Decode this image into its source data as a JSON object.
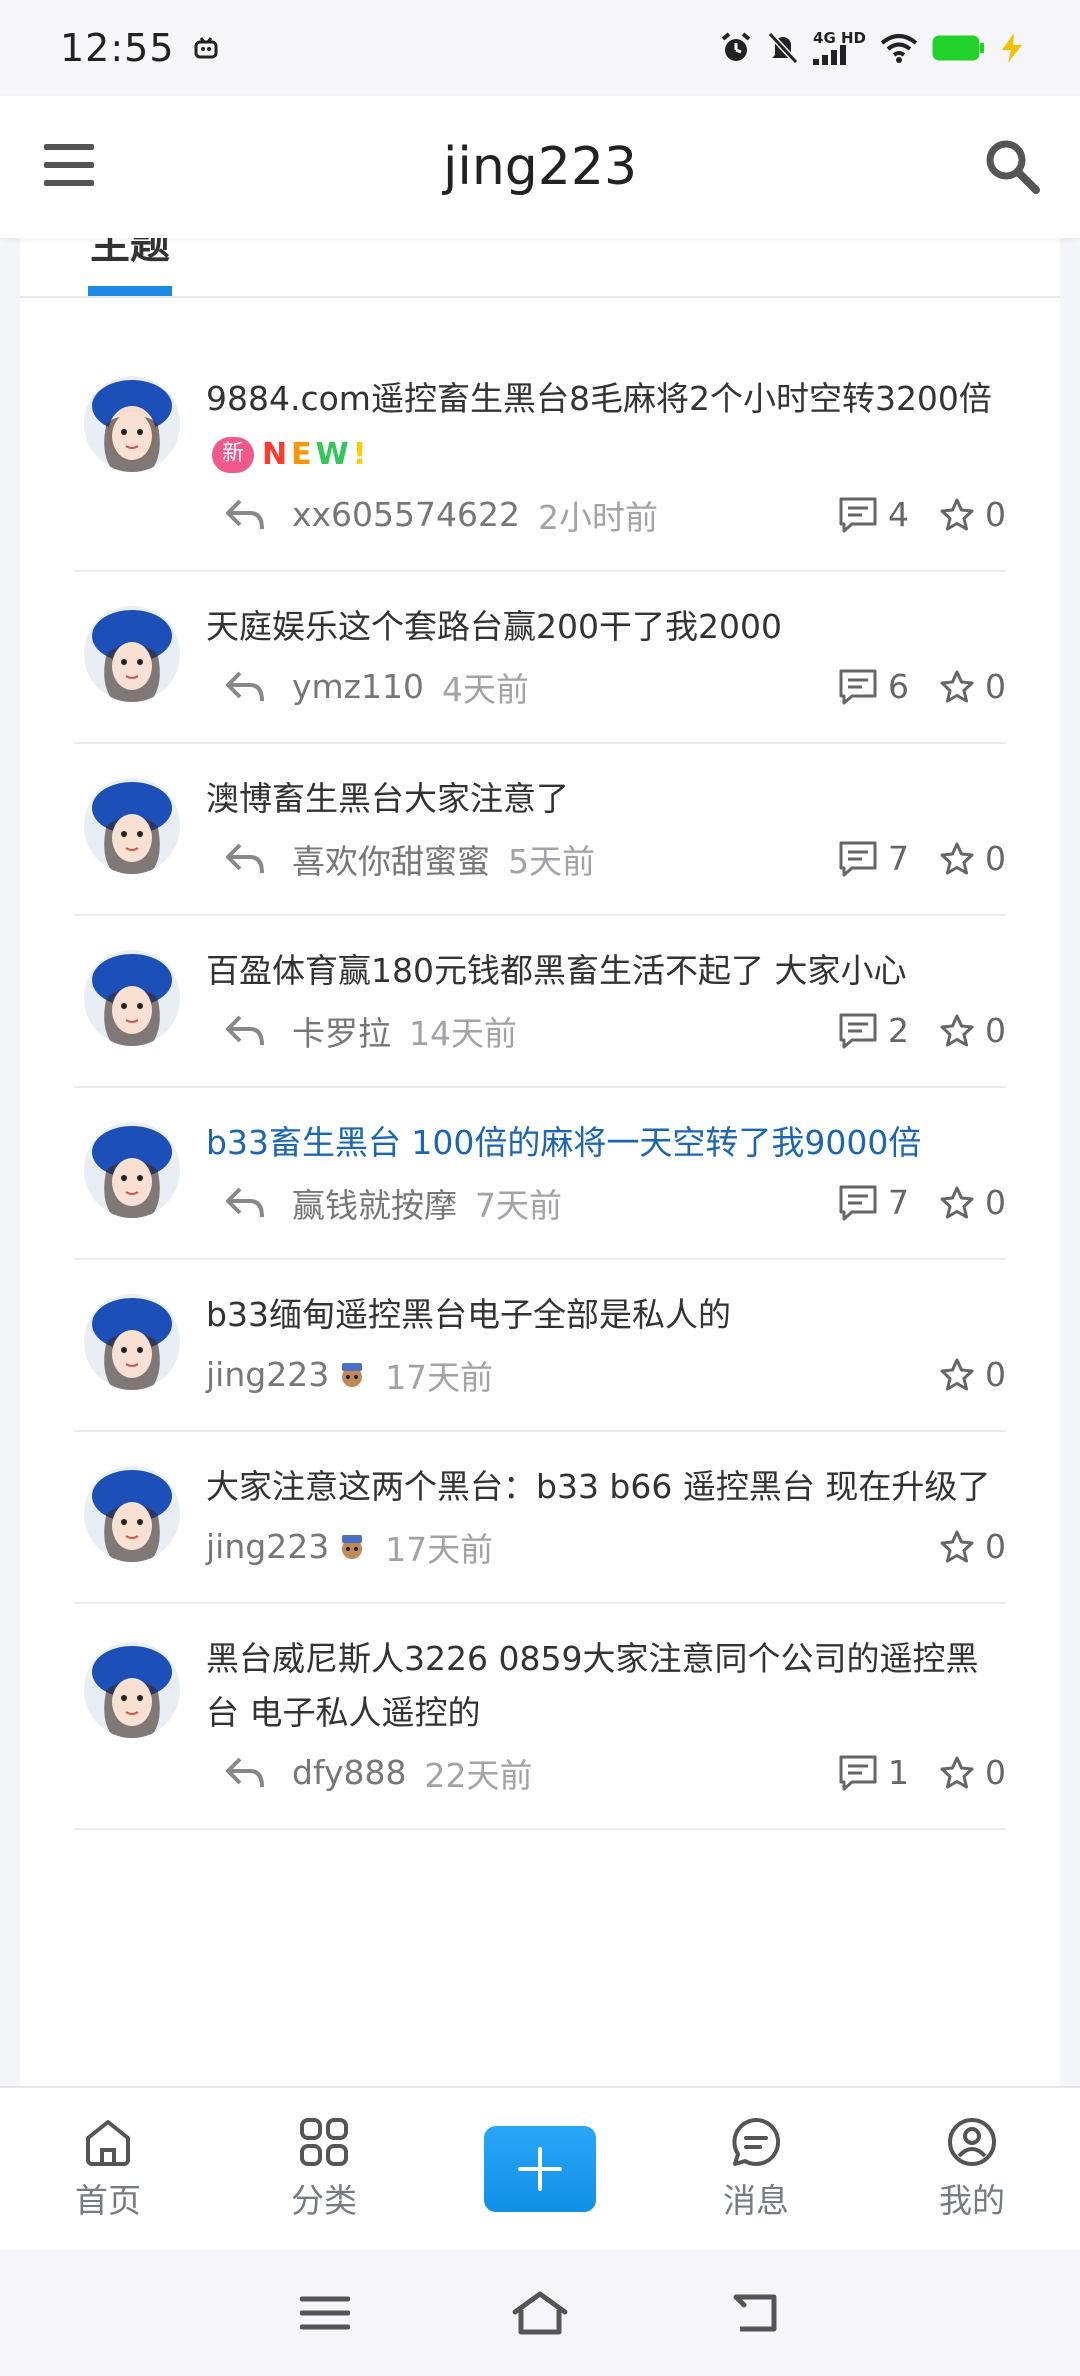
{
  "status_bar": {
    "time": "12:55",
    "network": "4G HD"
  },
  "header": {
    "title": "jing223"
  },
  "tabs": {
    "active_label": "主题"
  },
  "threads": [
    {
      "title": "9884.com遥控畜生黑台8毛麻将2个小时空转3200倍",
      "badge": "新",
      "new_tag": "NEW!",
      "author": "xx605574622",
      "time": "2小时前",
      "comments": "4",
      "favorites": "0"
    },
    {
      "title": "天庭娱乐这个套路台赢200干了我2000",
      "author": "ymz110",
      "time": "4天前",
      "comments": "6",
      "favorites": "0"
    },
    {
      "title": "澳博畜生黑台大家注意了",
      "author": "喜欢你甜蜜蜜",
      "time": "5天前",
      "comments": "7",
      "favorites": "0"
    },
    {
      "title": "百盈体育赢180元钱都黑畜生活不起了 大家小心",
      "author": "卡罗拉",
      "time": "14天前",
      "comments": "2",
      "favorites": "0"
    },
    {
      "title": "b33畜生黑台 100倍的麻将一天空转了我9000倍",
      "author": "赢钱就按摩",
      "time": "7天前",
      "comments": "7",
      "favorites": "0"
    },
    {
      "title": "b33缅甸遥控黑台电子全部是私人的",
      "author": "jing223",
      "time": "17天前",
      "favorites": "0"
    },
    {
      "title": "大家注意这两个黑台：b33 b66 遥控黑台 现在升级了",
      "author": "jing223",
      "time": "17天前",
      "favorites": "0"
    },
    {
      "title": "黑台威尼斯人3226 0859大家注意同个公司的遥控黑台 电子私人遥控的",
      "author": "dfy888",
      "time": "22天前",
      "comments": "1",
      "favorites": "0"
    }
  ],
  "bottom_nav": {
    "home": "首页",
    "category": "分类",
    "messages": "消息",
    "mine": "我的"
  },
  "colors": {
    "accent": "#1e88e5",
    "link": "#1a66b4",
    "badge": "#f0598a"
  }
}
